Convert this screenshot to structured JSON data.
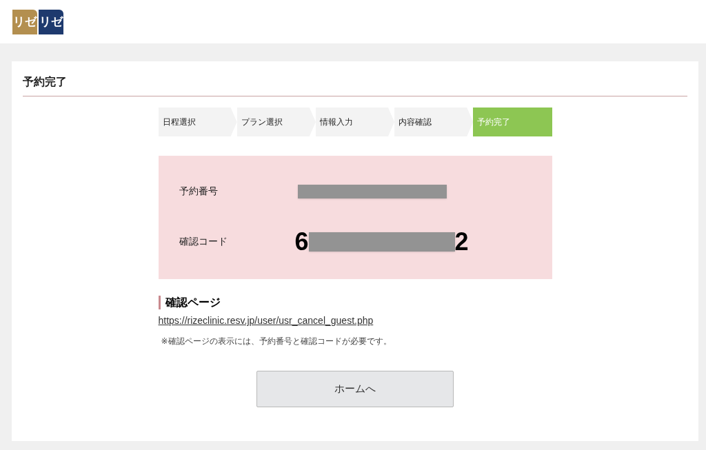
{
  "logo": {
    "left": "リゼ",
    "right": "リゼ"
  },
  "page_title": "予約完了",
  "steps": [
    {
      "label": "日程選択",
      "selected": false
    },
    {
      "label": "プラン選択",
      "selected": false
    },
    {
      "label": "情報入力",
      "selected": false
    },
    {
      "label": "内容確認",
      "selected": false
    },
    {
      "label": "予約完了",
      "selected": true
    }
  ],
  "result": {
    "reservation_label": "予約番号",
    "code_label": "確認コード",
    "code_start": "6",
    "code_end": "2"
  },
  "confirm_section": {
    "heading": "確認ページ",
    "link": "https://rizeclinic.resv.jp/user/usr_cancel_guest.php",
    "note": "※確認ページの表示には、予約番号と確認コードが必要です。"
  },
  "home_button": "ホームへ"
}
